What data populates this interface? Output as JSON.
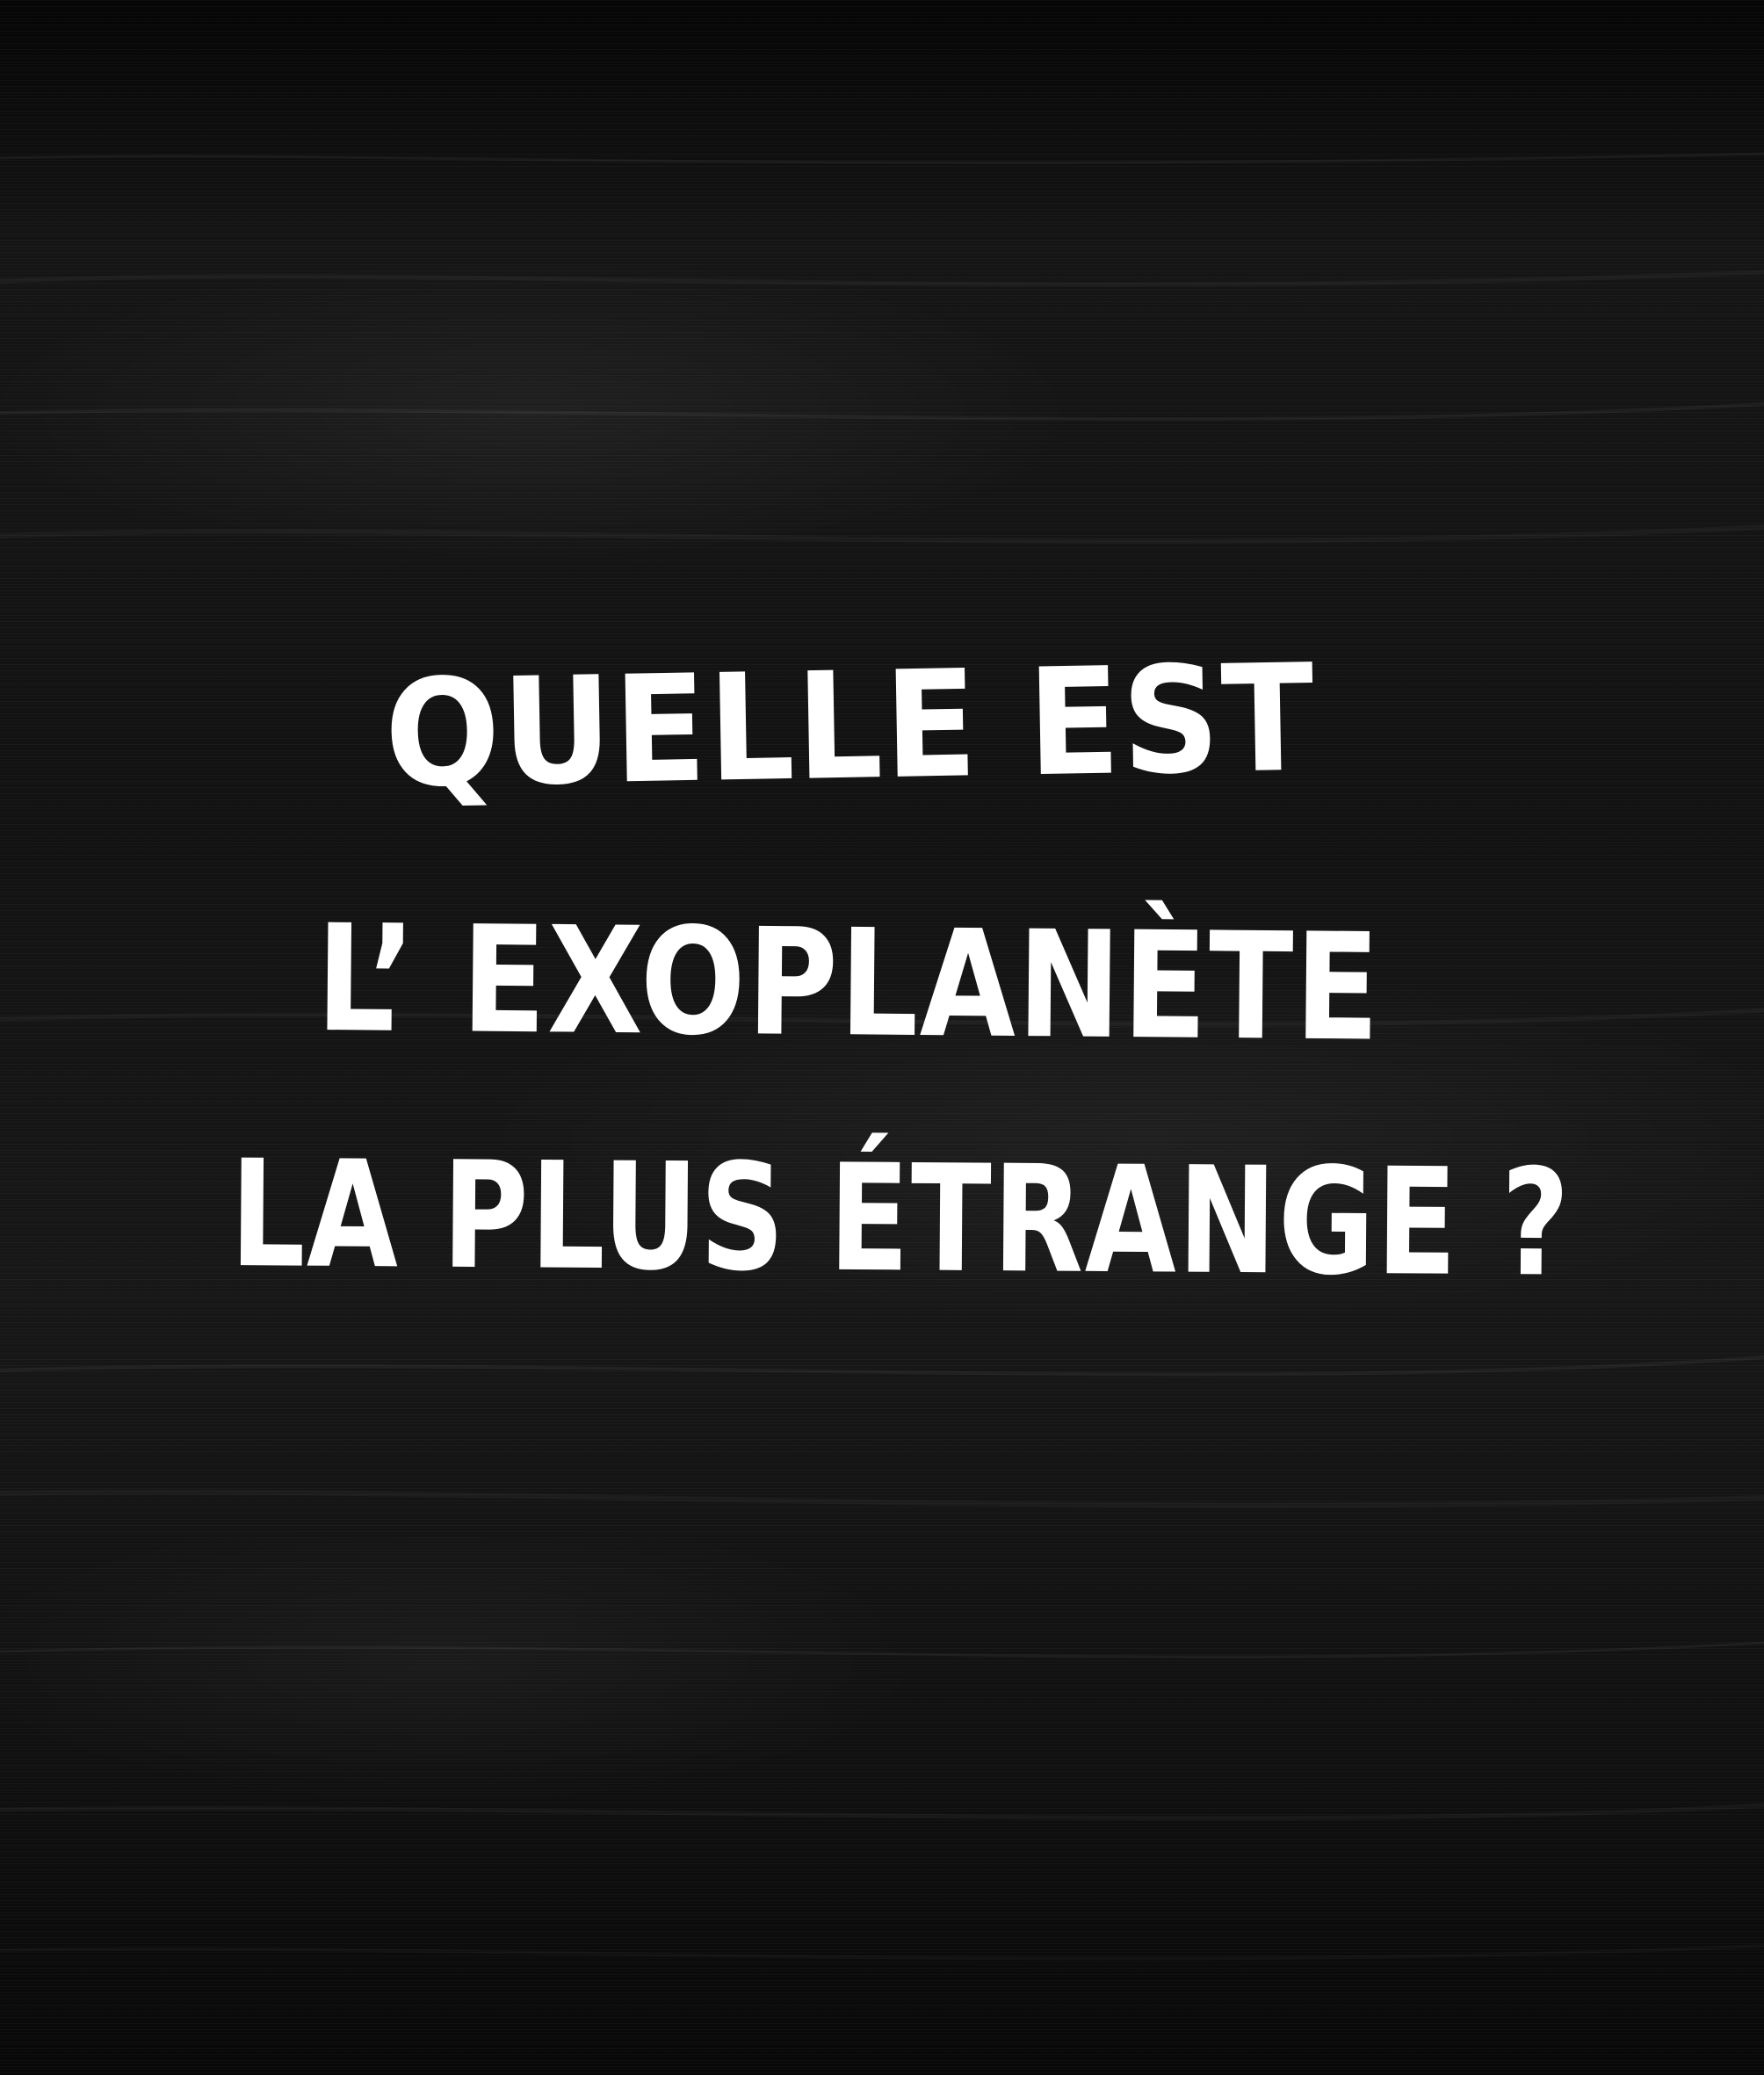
{
  "board": {
    "background_color": "#111111",
    "text_color": "#ffffff"
  },
  "headline": {
    "line1": "QUELLE EST",
    "line2": "L’ EXOPLANÈTE",
    "line3": "LA PLUS ÉTRANGE ?"
  }
}
